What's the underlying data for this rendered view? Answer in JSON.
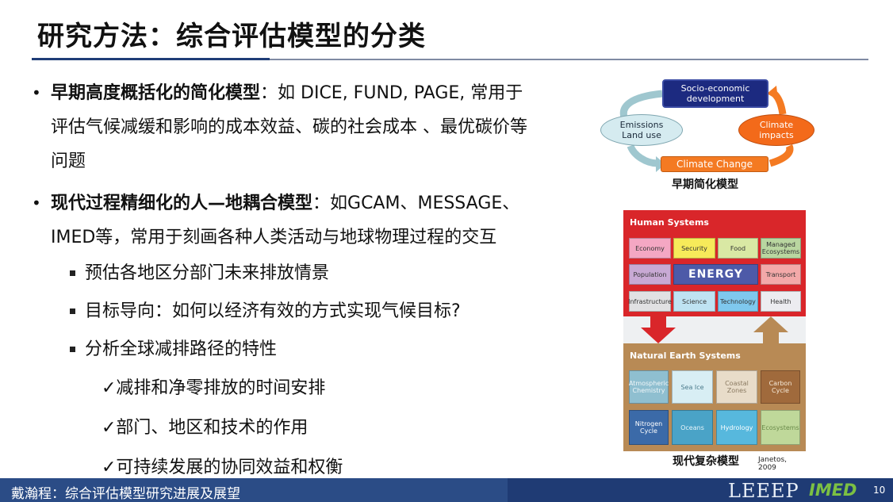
{
  "slide": {
    "title": "研究方法：综合评估模型的分类"
  },
  "bullets": {
    "b1_bold": "早期高度概括化的简化模型",
    "b1_line1": "：如 DICE, FUND, PAGE, 常用于",
    "b1_line2": "评估气候减缓和影响的成本效益、碳的社会成本 、最优碳价等",
    "b1_line3": "问题",
    "b2_bold": "现代过程精细化的人—地耦合模型",
    "b2_line1": "：如GCAM、MESSAGE、",
    "b2_line2": "IMED等，常用于刻画各种人类活动与地球物理过程的交互",
    "sub1": "预估各地区分部门未来排放情景",
    "sub2": "目标导向：如何以经济有效的方式实现气候目标?",
    "sub3": "分析全球减排路径的特性",
    "check1": "✓减排和净零排放的时间安排",
    "check2": "✓部门、地区和技术的作用",
    "check3": "✓可持续发展的协同效益和权衡"
  },
  "diagram_early": {
    "socio_l1": "Socio-economic",
    "socio_l2": "development",
    "emissions_l1": "Emissions",
    "emissions_l2": "Land use",
    "impacts_l1": "Climate",
    "impacts_l2": "impacts",
    "climate_change": "Climate Change",
    "caption": "早期简化模型"
  },
  "diagram_complex": {
    "human_label": "Human Systems",
    "economy": "Economy",
    "security": "Security",
    "food": "Food",
    "managed_l1": "Managed",
    "managed_l2": "Ecosystems",
    "population": "Population",
    "energy": "ENERGY",
    "transport": "Transport",
    "infrastructure": "Infrastructure",
    "science": "Science",
    "technology": "Technology",
    "health": "Health",
    "natural_label": "Natural Earth Systems",
    "atmos_l1": "Atmospheric",
    "atmos_l2": "Chemistry",
    "sea_ice": "Sea Ice",
    "coastal_l1": "Coastal",
    "coastal_l2": "Zones",
    "carbon_l1": "Carbon",
    "carbon_l2": "Cycle",
    "nitrogen_l1": "Nitrogen",
    "nitrogen_l2": "Cycle",
    "oceans": "Oceans",
    "hydrology": "Hydrology",
    "ecosystems": "Ecosystems",
    "caption": "现代复杂模型",
    "citation": "Janetos, 2009"
  },
  "footer": {
    "text": "戴瀚程：综合评估模型研究进展及展望",
    "logo1": "LEEEP",
    "logo2": "IMED",
    "page": "10"
  },
  "colors": {
    "accent_navy": "#1f3b74",
    "human_red": "#d9262a",
    "natural_brown": "#b88a55",
    "orange": "#f47a22"
  }
}
